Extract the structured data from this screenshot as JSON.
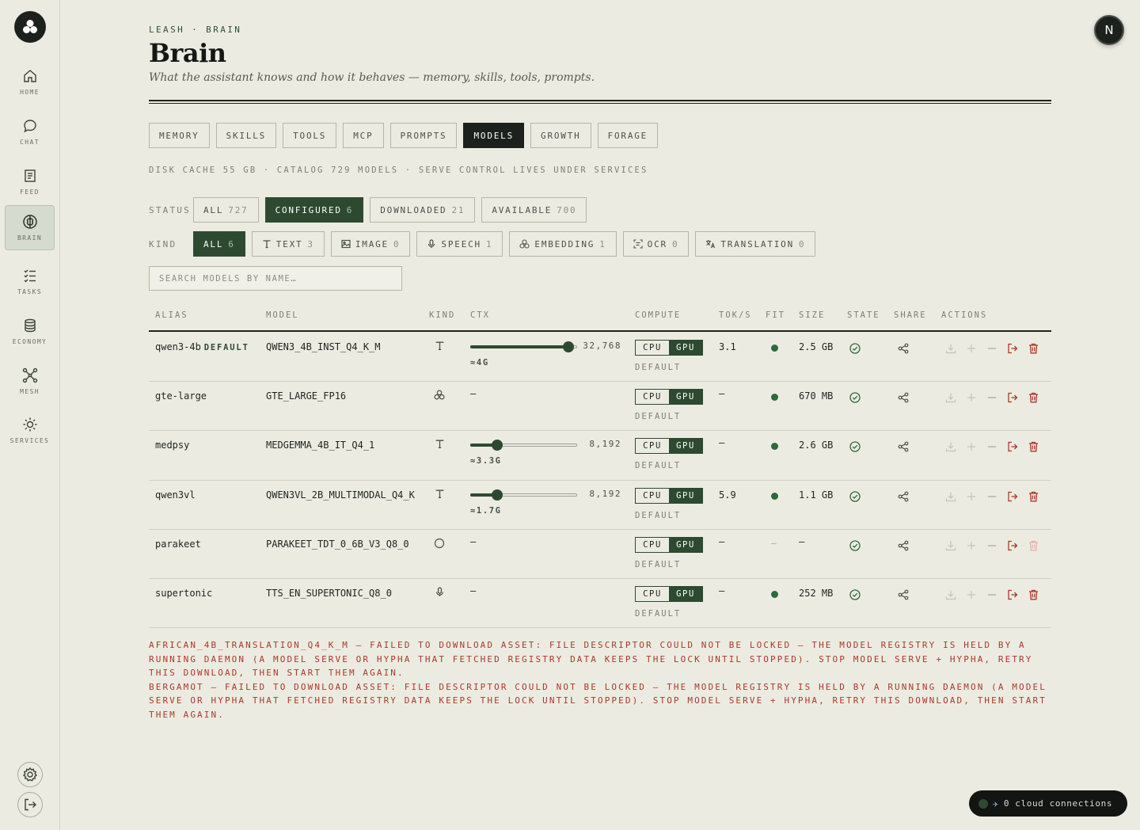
{
  "sidebar": {
    "items": [
      {
        "label": "HOME"
      },
      {
        "label": "CHAT"
      },
      {
        "label": "FEED"
      },
      {
        "label": "BRAIN"
      },
      {
        "label": "TASKS"
      },
      {
        "label": "ECONOMY"
      },
      {
        "label": "MESH"
      },
      {
        "label": "SERVICES"
      }
    ],
    "active": "BRAIN"
  },
  "header": {
    "breadcrumb": "LEASH · BRAIN",
    "title": "Brain",
    "subtitle": "What the assistant knows and how it behaves — memory, skills, tools, prompts.",
    "avatar_initial": "N"
  },
  "tabs": [
    {
      "label": "MEMORY"
    },
    {
      "label": "SKILLS"
    },
    {
      "label": "TOOLS"
    },
    {
      "label": "MCP"
    },
    {
      "label": "PROMPTS"
    },
    {
      "label": "MODELS"
    },
    {
      "label": "GROWTH"
    },
    {
      "label": "FORAGE"
    }
  ],
  "active_tab": "MODELS",
  "meta_line": "DISK CACHE 55 GB · CATALOG 729 MODELS · SERVE CONTROL LIVES UNDER SERVICES",
  "status_filter": {
    "label": "STATUS",
    "chips": [
      {
        "label": "ALL",
        "count": "727"
      },
      {
        "label": "CONFIGURED",
        "count": "6"
      },
      {
        "label": "DOWNLOADED",
        "count": "21"
      },
      {
        "label": "AVAILABLE",
        "count": "700"
      }
    ],
    "active": "CONFIGURED"
  },
  "kind_filter": {
    "label": "KIND",
    "chips": [
      {
        "label": "ALL",
        "count": "6"
      },
      {
        "label": "TEXT",
        "count": "3"
      },
      {
        "label": "IMAGE",
        "count": "0"
      },
      {
        "label": "SPEECH",
        "count": "1"
      },
      {
        "label": "EMBEDDING",
        "count": "1"
      },
      {
        "label": "OCR",
        "count": "0"
      },
      {
        "label": "TRANSLATION",
        "count": "0"
      }
    ],
    "active": "ALL"
  },
  "search": {
    "placeholder": "SEARCH MODELS BY NAME…",
    "value": ""
  },
  "table": {
    "columns": [
      "ALIAS",
      "MODEL",
      "KIND",
      "CTX",
      "COMPUTE",
      "TOK/S",
      "FIT",
      "SIZE",
      "STATE",
      "SHARE",
      "ACTIONS"
    ],
    "default_tag": "DEFAULT",
    "compute_default": "DEFAULT",
    "cpu_label": "CPU",
    "gpu_label": "GPU",
    "rows": [
      {
        "alias": "qwen3-4b",
        "is_default": true,
        "model": "QWEN3_4B_INST_Q4_K_M",
        "kind": "text",
        "ctx": "32,768",
        "ctx_fraction": 0.92,
        "ctx_mem": "≈4G",
        "toks": "3.1",
        "fit": true,
        "size": "2.5 GB"
      },
      {
        "alias": "gte-large",
        "is_default": false,
        "model": "GTE_LARGE_FP16",
        "kind": "embedding",
        "ctx": "—",
        "toks": "—",
        "fit": true,
        "size": "670 MB"
      },
      {
        "alias": "medpsy",
        "is_default": false,
        "model": "MEDGEMMA_4B_IT_Q4_1",
        "kind": "text",
        "ctx": "8,192",
        "ctx_fraction": 0.25,
        "ctx_mem": "≈3.3G",
        "toks": "—",
        "fit": true,
        "size": "2.6 GB"
      },
      {
        "alias": "qwen3vl",
        "is_default": false,
        "model": "QWEN3VL_2B_MULTIMODAL_Q4_K",
        "kind": "text",
        "ctx": "8,192",
        "ctx_fraction": 0.25,
        "ctx_mem": "≈1.7G",
        "toks": "5.9",
        "fit": true,
        "size": "1.1 GB"
      },
      {
        "alias": "parakeet",
        "is_default": false,
        "model": "PARAKEET_TDT_0_6B_V3_Q8_0",
        "kind": "unknown",
        "ctx": "—",
        "toks": "—",
        "fit": false,
        "fit_text": "—",
        "size": "—"
      },
      {
        "alias": "supertonic",
        "is_default": false,
        "model": "TTS_EN_SUPERTONIC_Q8_0",
        "kind": "speech",
        "ctx": "—",
        "toks": "—",
        "fit": true,
        "size": "252 MB"
      }
    ]
  },
  "errors": [
    "AFRICAN_4B_TRANSLATION_Q4_K_M — FAILED TO DOWNLOAD ASSET: FILE DESCRIPTOR COULD NOT BE LOCKED — THE MODEL REGISTRY IS HELD BY A RUNNING DAEMON (A MODEL SERVE OR HYPHA THAT FETCHED REGISTRY DATA KEEPS THE LOCK UNTIL STOPPED). STOP MODEL SERVE + HYPHA, RETRY THIS DOWNLOAD, THEN START THEM AGAIN.",
    "BERGAMOT — FAILED TO DOWNLOAD ASSET: FILE DESCRIPTOR COULD NOT BE LOCKED — THE MODEL REGISTRY IS HELD BY A RUNNING DAEMON (A MODEL SERVE OR HYPHA THAT FETCHED REGISTRY DATA KEEPS THE LOCK UNTIL STOPPED). STOP MODEL SERVE + HYPHA, RETRY THIS DOWNLOAD, THEN START THEM AGAIN."
  ],
  "cloud": {
    "label": "0 cloud connections",
    "icon": "airplane-icon"
  },
  "colors": {
    "accent": "#2d4a30",
    "error": "#a83a2a",
    "background": "#ecebe2",
    "dark": "#1d211d"
  }
}
